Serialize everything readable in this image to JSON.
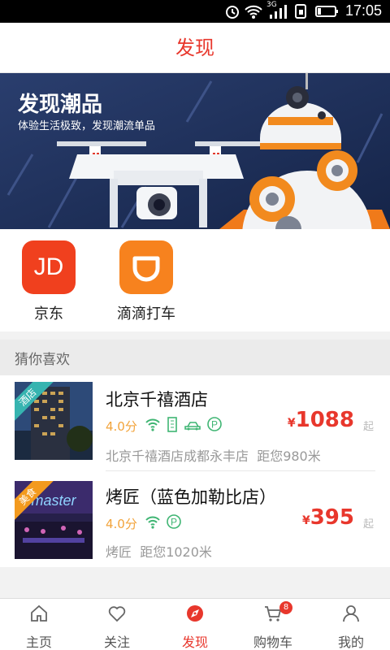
{
  "status_bar": {
    "time": "17:05",
    "network": "3G"
  },
  "header": {
    "title": "发现"
  },
  "banner": {
    "title": "发现潮品",
    "subtitle": "体验生活极致，发现潮流单品"
  },
  "apps": [
    {
      "label": "京东",
      "icon": "jd-icon",
      "icon_text": "JD",
      "color": "#f0401e"
    },
    {
      "label": "滴滴打车",
      "icon": "didi-icon",
      "color": "#f7821e"
    }
  ],
  "section": {
    "title": "猜你喜欢"
  },
  "items": [
    {
      "tag": "酒店",
      "name": "北京千禧酒店",
      "rating": "4.0分",
      "amenities": [
        "wifi-icon",
        "building-icon",
        "car-icon",
        "parking-icon"
      ],
      "address": "北京千禧酒店成都永丰店",
      "distance": "距您980米",
      "price_currency": "¥",
      "price": "1088",
      "price_suffix": "起"
    },
    {
      "tag": "美食",
      "name": "烤匠（蓝色加勒比店）",
      "rating": "4.0分",
      "amenities": [
        "wifi-icon",
        "parking-icon"
      ],
      "address": "烤匠",
      "distance": "距您1020米",
      "price_currency": "¥",
      "price": "395",
      "price_suffix": "起"
    }
  ],
  "tabbar": [
    {
      "label": "主页",
      "icon": "home-icon"
    },
    {
      "label": "关注",
      "icon": "heart-icon"
    },
    {
      "label": "发现",
      "icon": "discover-icon",
      "active": true
    },
    {
      "label": "购物车",
      "icon": "cart-icon",
      "badge": "8"
    },
    {
      "label": "我的",
      "icon": "user-icon"
    }
  ],
  "colors": {
    "accent": "#e8372c",
    "rating": "#f2a33a",
    "amenity": "#3fb573"
  }
}
